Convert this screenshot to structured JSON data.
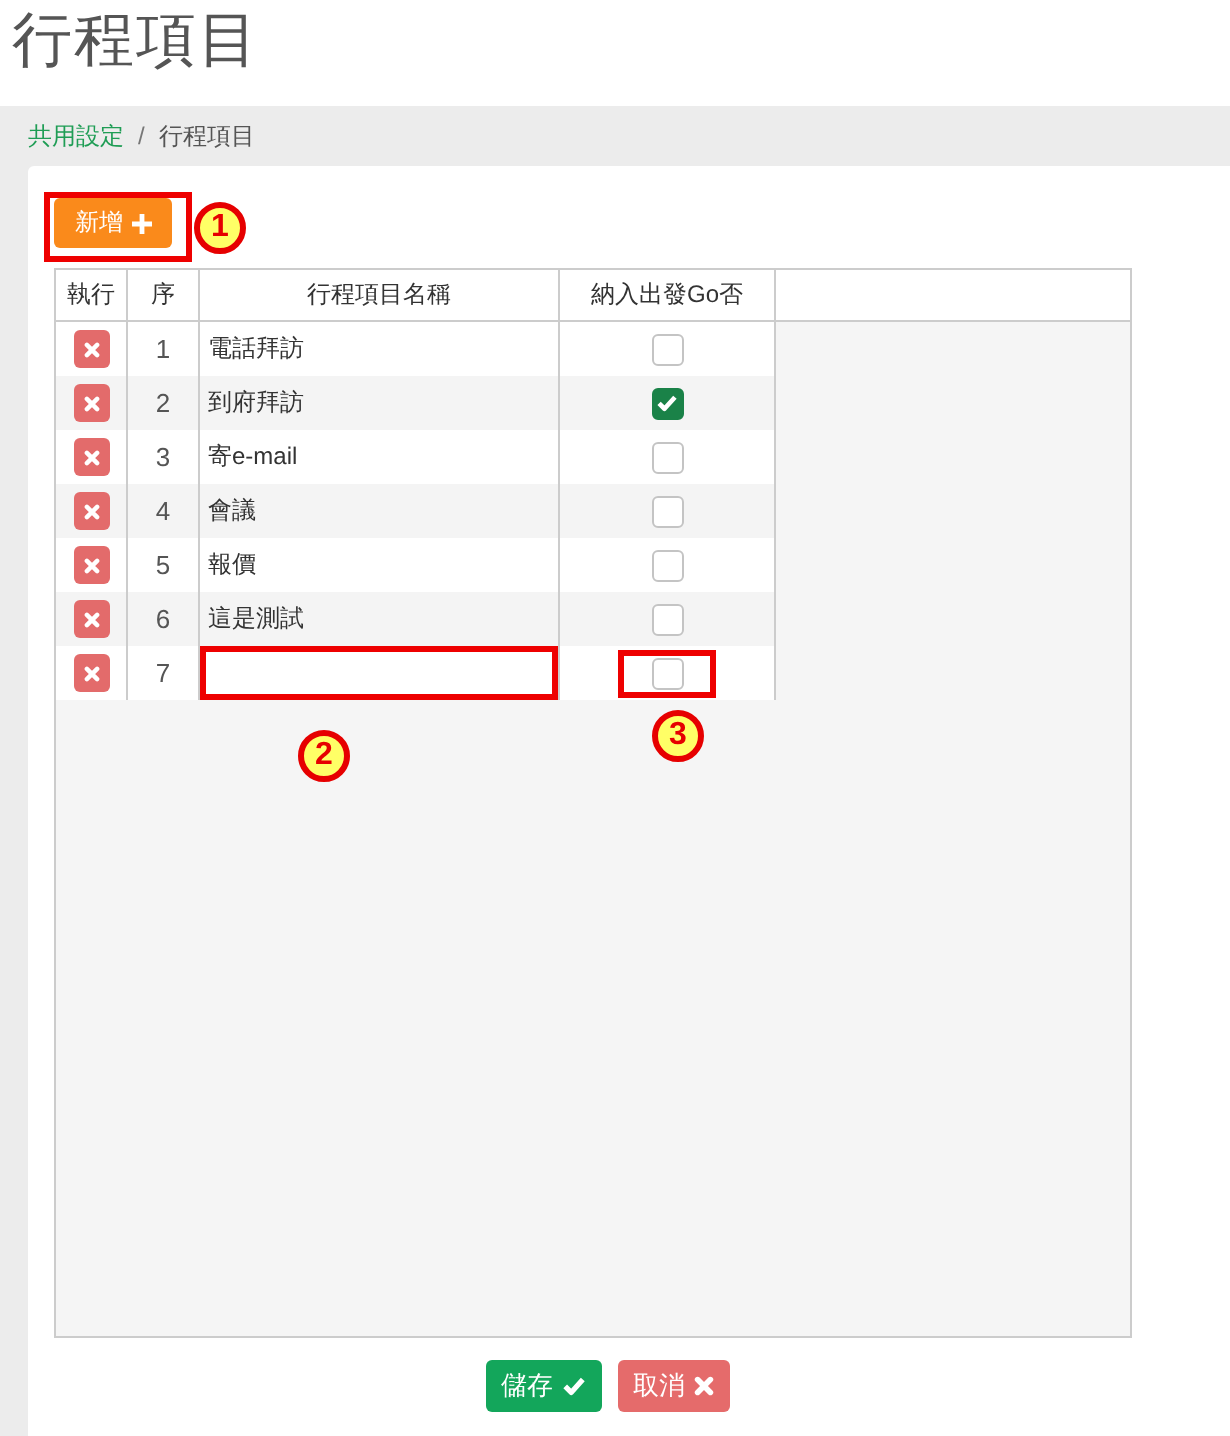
{
  "page": {
    "title": "行程項目"
  },
  "breadcrumb": {
    "items": [
      {
        "label": "共用設定",
        "kind": "link"
      },
      {
        "label": "行程項目",
        "kind": "current"
      }
    ],
    "separator": "/"
  },
  "toolbar": {
    "add_button": {
      "label": "新增",
      "annotation": "1"
    }
  },
  "table": {
    "columns": [
      "執行",
      "序",
      "行程項目名稱",
      "納入出發Go否"
    ],
    "rows": [
      {
        "kind": "item",
        "index": "1",
        "name": "電話拜訪",
        "checked": false
      },
      {
        "kind": "item",
        "index": "2",
        "name": "到府拜訪",
        "checked": true
      },
      {
        "kind": "item",
        "index": "3",
        "name": "寄e-mail",
        "checked": false
      },
      {
        "kind": "item",
        "index": "4",
        "name": "會議",
        "checked": false
      },
      {
        "kind": "item",
        "index": "5",
        "name": "報價",
        "checked": false
      },
      {
        "kind": "item",
        "index": "6",
        "name": "這是測試",
        "checked": false
      },
      {
        "kind": "new",
        "index": "7",
        "checked": false,
        "name_annotation": "2",
        "check_annotation": "3"
      }
    ]
  },
  "footer": {
    "buttons": [
      {
        "label": "儲存",
        "kind": "save"
      },
      {
        "label": "取消",
        "kind": "cancel"
      }
    ]
  }
}
